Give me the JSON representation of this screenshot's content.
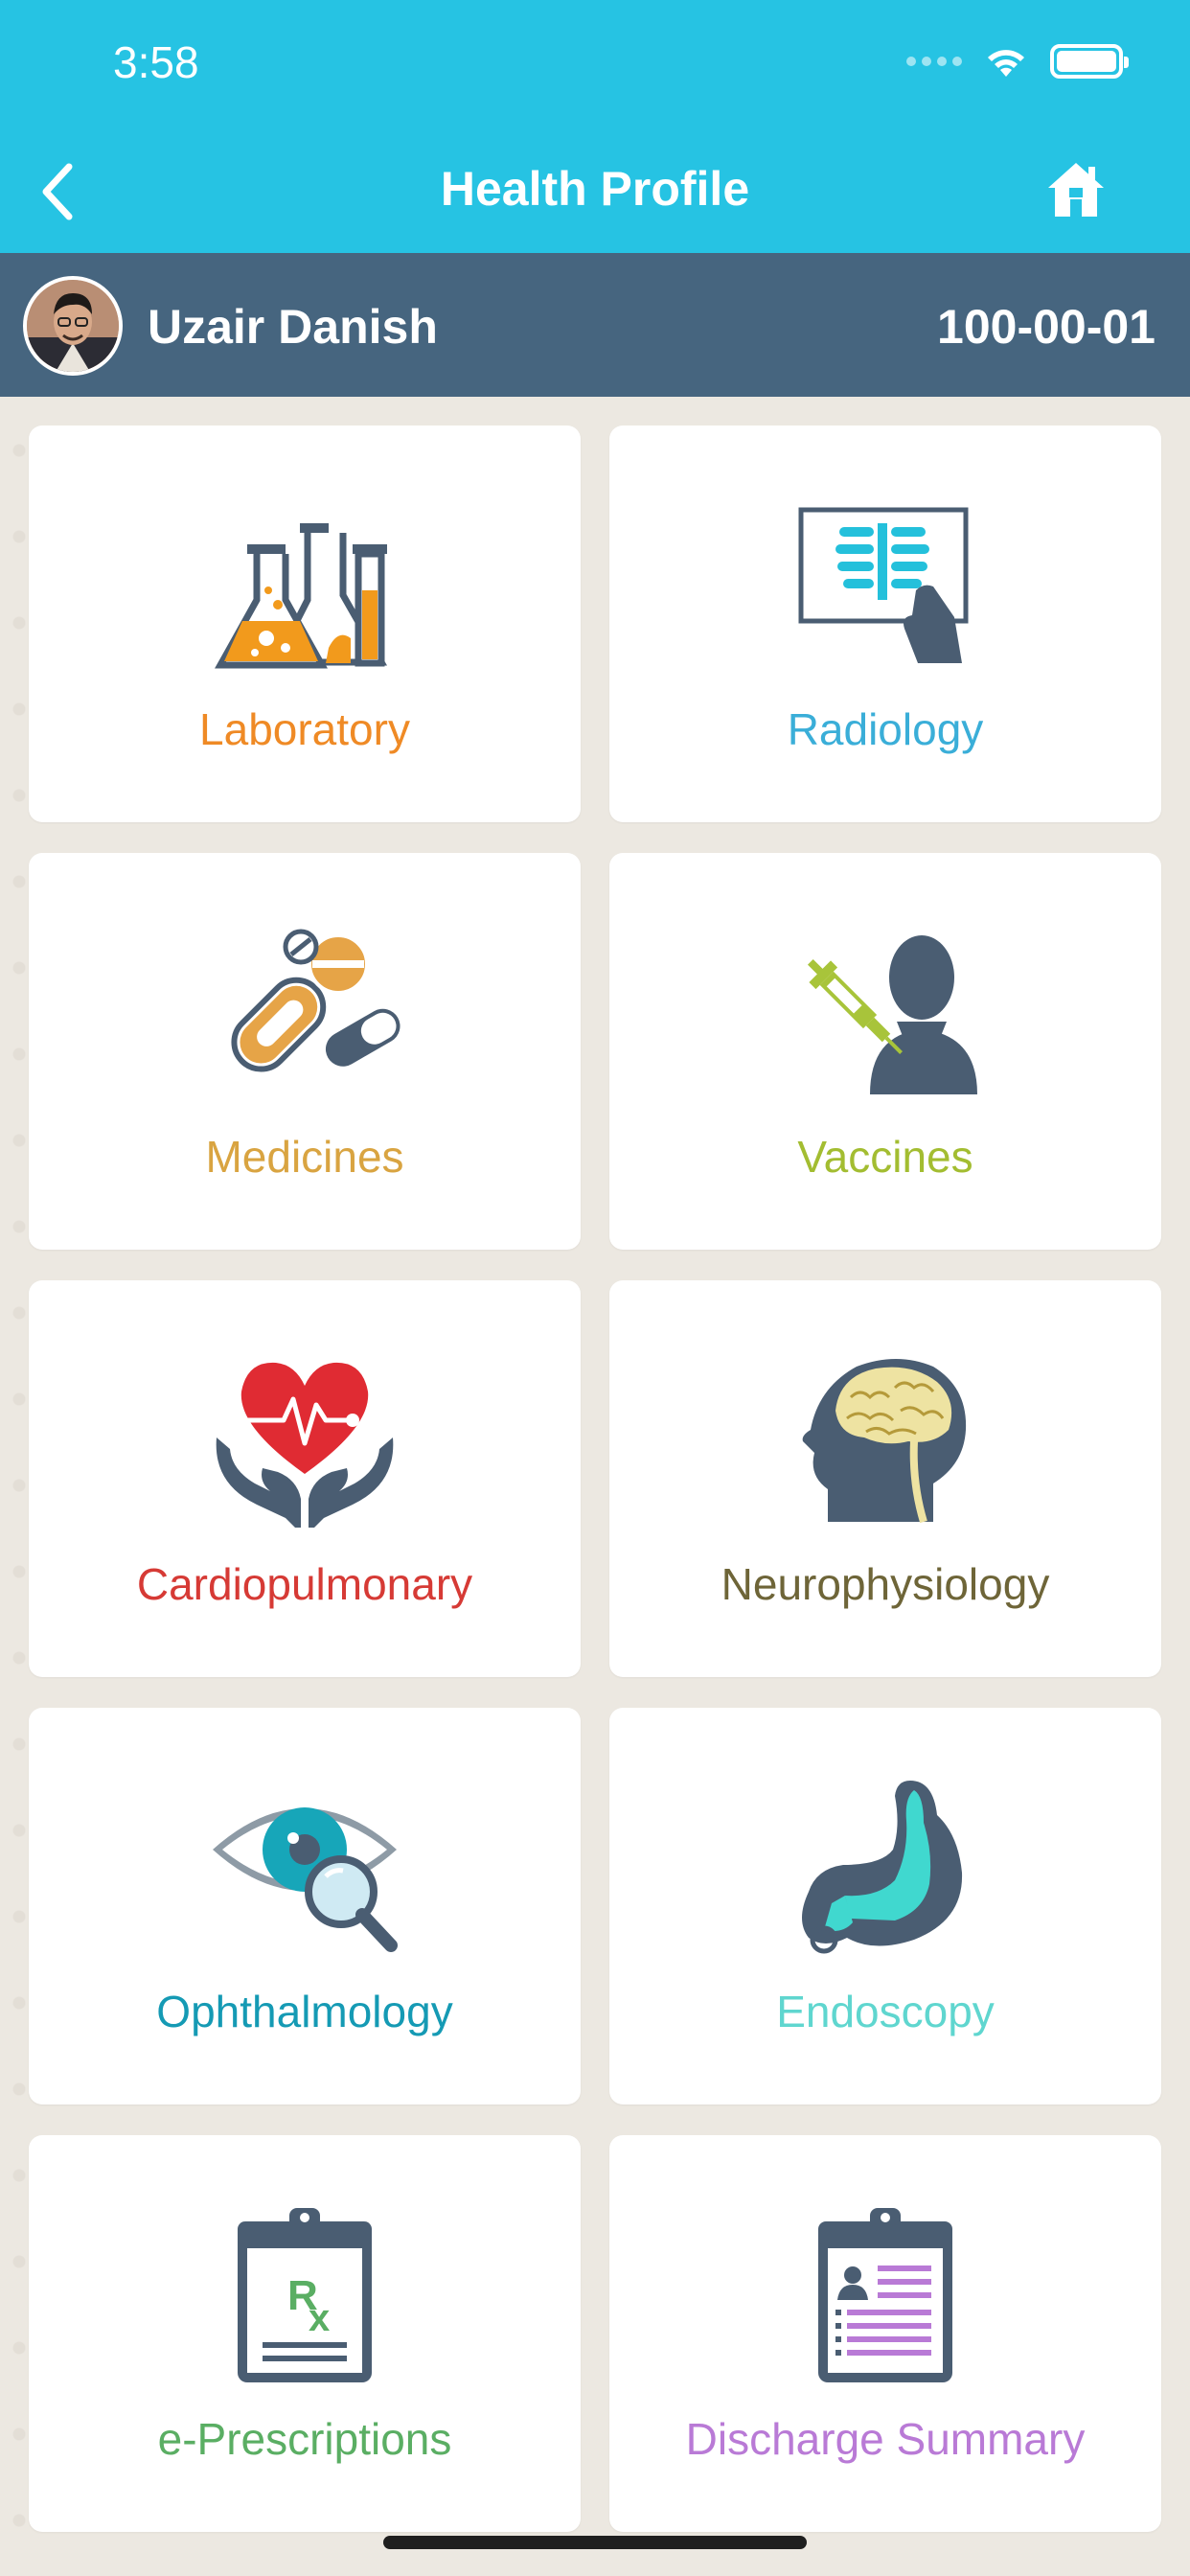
{
  "status_bar": {
    "time": "3:58"
  },
  "nav": {
    "title": "Health Profile",
    "back_icon": "chevron-left-icon",
    "home_icon": "home-icon"
  },
  "user": {
    "name": "Uzair Danish",
    "id": "100-00-01"
  },
  "tiles": [
    {
      "label": "Laboratory",
      "color": "#ef8a25",
      "icon": "lab-flasks-icon"
    },
    {
      "label": "Radiology",
      "color": "#3aaed8",
      "icon": "xray-icon"
    },
    {
      "label": "Medicines",
      "color": "#d9a441",
      "icon": "pills-icon"
    },
    {
      "label": "Vaccines",
      "color": "#a3bd31",
      "icon": "syringe-person-icon"
    },
    {
      "label": "Cardiopulmonary",
      "color": "#d63a35",
      "icon": "heart-hands-icon"
    },
    {
      "label": "Neurophysiology",
      "color": "#6e6538",
      "icon": "brain-head-icon"
    },
    {
      "label": "Ophthalmology",
      "color": "#159ab4",
      "icon": "eye-magnifier-icon"
    },
    {
      "label": "Endoscopy",
      "color": "#5fd6cf",
      "icon": "stomach-icon"
    },
    {
      "label": "e-Prescriptions",
      "color": "#5aae63",
      "icon": "rx-clipboard-icon"
    },
    {
      "label": "Discharge Summary",
      "color": "#b97ad6",
      "icon": "summary-clipboard-icon"
    }
  ]
}
